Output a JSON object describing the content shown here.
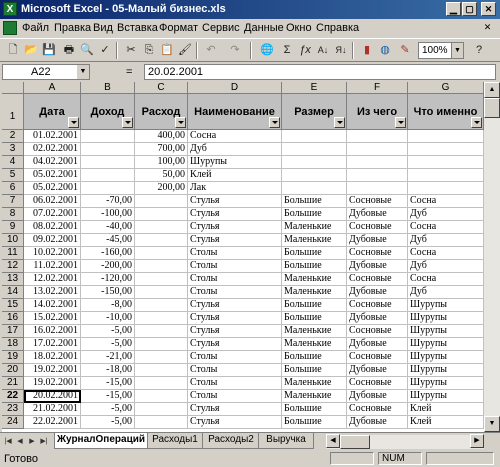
{
  "window": {
    "title": "Microsoft Excel - 05-Малый бизнес.xls"
  },
  "menu": [
    "Файл",
    "Правка",
    "Вид",
    "Вставка",
    "Формат",
    "Сервис",
    "Данные",
    "Окно",
    "Справка"
  ],
  "toolbar": {
    "zoom": "100%"
  },
  "formula_bar": {
    "name_box": "A22",
    "equals": "=",
    "value": "20.02.2001"
  },
  "columns": [
    "A",
    "B",
    "C",
    "D",
    "E",
    "F",
    "G"
  ],
  "headers": [
    "Дата",
    "Доход",
    "Расход",
    "Наименование",
    "Размер",
    "Из чего",
    "Что именно"
  ],
  "rows": [
    {
      "num": "2",
      "cells": [
        "01.02.2001",
        "",
        "400,00",
        "Сосна",
        "",
        "",
        ""
      ]
    },
    {
      "num": "3",
      "cells": [
        "02.02.2001",
        "",
        "700,00",
        "Дуб",
        "",
        "",
        ""
      ]
    },
    {
      "num": "4",
      "cells": [
        "04.02.2001",
        "",
        "100,00",
        "Шурупы",
        "",
        "",
        ""
      ]
    },
    {
      "num": "5",
      "cells": [
        "05.02.2001",
        "",
        "50,00",
        "Клей",
        "",
        "",
        ""
      ]
    },
    {
      "num": "6",
      "cells": [
        "05.02.2001",
        "",
        "200,00",
        "Лак",
        "",
        "",
        ""
      ]
    },
    {
      "num": "7",
      "cells": [
        "06.02.2001",
        "-70,00",
        "",
        "Стулья",
        "Большие",
        "Сосновые",
        "Сосна"
      ]
    },
    {
      "num": "8",
      "cells": [
        "07.02.2001",
        "-100,00",
        "",
        "Стулья",
        "Большие",
        "Дубовые",
        "Дуб"
      ]
    },
    {
      "num": "9",
      "cells": [
        "08.02.2001",
        "-40,00",
        "",
        "Стулья",
        "Маленькие",
        "Сосновые",
        "Сосна"
      ]
    },
    {
      "num": "10",
      "cells": [
        "09.02.2001",
        "-45,00",
        "",
        "Стулья",
        "Маленькие",
        "Дубовые",
        "Дуб"
      ]
    },
    {
      "num": "11",
      "cells": [
        "10.02.2001",
        "-160,00",
        "",
        "Столы",
        "Большие",
        "Сосновые",
        "Сосна"
      ]
    },
    {
      "num": "12",
      "cells": [
        "11.02.2001",
        "-200,00",
        "",
        "Столы",
        "Большие",
        "Дубовые",
        "Дуб"
      ]
    },
    {
      "num": "13",
      "cells": [
        "12.02.2001",
        "-120,00",
        "",
        "Столы",
        "Маленькие",
        "Сосновые",
        "Сосна"
      ]
    },
    {
      "num": "14",
      "cells": [
        "13.02.2001",
        "-150,00",
        "",
        "Столы",
        "Маленькие",
        "Дубовые",
        "Дуб"
      ]
    },
    {
      "num": "15",
      "cells": [
        "14.02.2001",
        "-8,00",
        "",
        "Стулья",
        "Большие",
        "Сосновые",
        "Шурупы"
      ]
    },
    {
      "num": "16",
      "cells": [
        "15.02.2001",
        "-10,00",
        "",
        "Стулья",
        "Большие",
        "Дубовые",
        "Шурупы"
      ]
    },
    {
      "num": "17",
      "cells": [
        "16.02.2001",
        "-5,00",
        "",
        "Стулья",
        "Маленькие",
        "Сосновые",
        "Шурупы"
      ]
    },
    {
      "num": "18",
      "cells": [
        "17.02.2001",
        "-5,00",
        "",
        "Стулья",
        "Маленькие",
        "Дубовые",
        "Шурупы"
      ]
    },
    {
      "num": "19",
      "cells": [
        "18.02.2001",
        "-21,00",
        "",
        "Столы",
        "Большие",
        "Сосновые",
        "Шурупы"
      ]
    },
    {
      "num": "20",
      "cells": [
        "19.02.2001",
        "-18,00",
        "",
        "Столы",
        "Большие",
        "Дубовые",
        "Шурупы"
      ]
    },
    {
      "num": "21",
      "cells": [
        "19.02.2001",
        "-15,00",
        "",
        "Столы",
        "Маленькие",
        "Сосновые",
        "Шурупы"
      ]
    },
    {
      "num": "22",
      "cells": [
        "20.02.2001",
        "-15,00",
        "",
        "Столы",
        "Маленькие",
        "Дубовые",
        "Шурупы"
      ]
    },
    {
      "num": "23",
      "cells": [
        "21.02.2001",
        "-5,00",
        "",
        "Стулья",
        "Большие",
        "Сосновые",
        "Клей"
      ]
    },
    {
      "num": "24",
      "cells": [
        "22.02.2001",
        "-5,00",
        "",
        "Стулья",
        "Большие",
        "Дубовые",
        "Клей"
      ]
    }
  ],
  "sheet_tabs": [
    "ЖурналОпераций",
    "Расходы1",
    "Расходы2",
    "Выручка"
  ],
  "status": {
    "text": "Готово",
    "num": "NUM"
  }
}
